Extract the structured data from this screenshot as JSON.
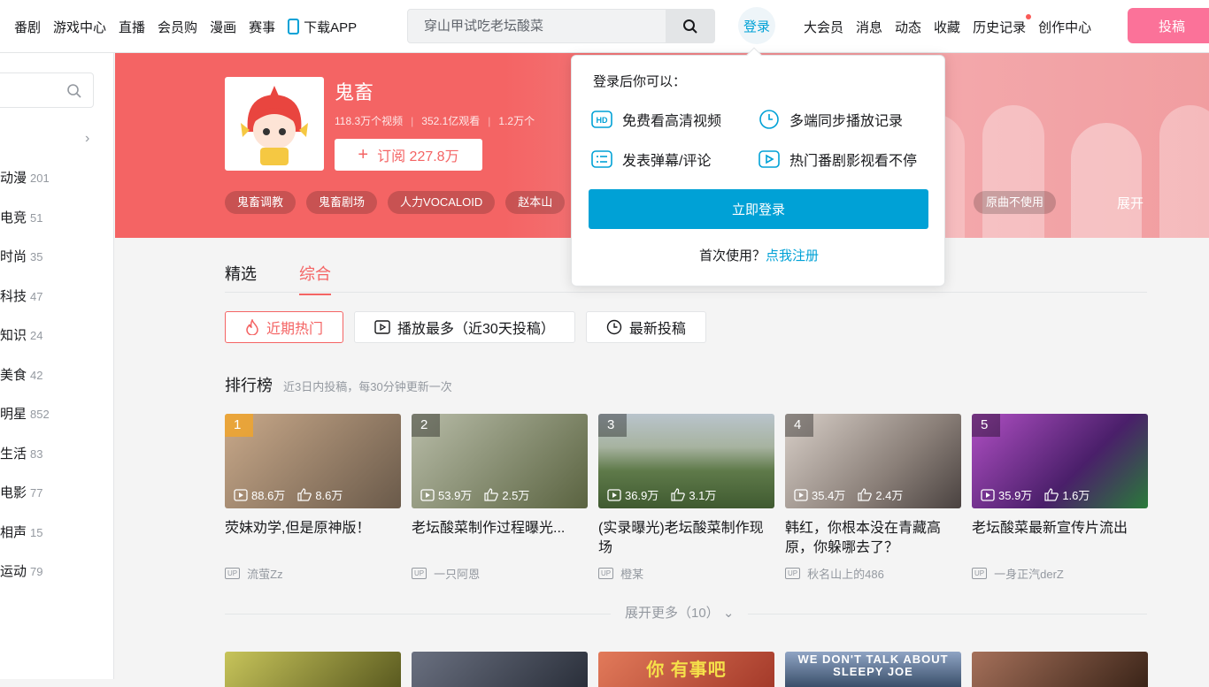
{
  "header": {
    "nav_left": [
      "番剧",
      "游戏中心",
      "直播",
      "会员购",
      "漫画",
      "赛事"
    ],
    "download_app": "下载APP",
    "search_placeholder": "穿山甲试吃老坛酸菜",
    "login": "登录",
    "nav_right": [
      "大会员",
      "消息",
      "动态",
      "收藏",
      "历史记录",
      "创作中心"
    ],
    "upload": "投稿"
  },
  "sidebar": {
    "items": [
      {
        "label": "动漫",
        "count": "201"
      },
      {
        "label": "电竞",
        "count": "51"
      },
      {
        "label": "时尚",
        "count": "35"
      },
      {
        "label": "科技",
        "count": "47"
      },
      {
        "label": "知识",
        "count": "24"
      },
      {
        "label": "美食",
        "count": "42"
      },
      {
        "label": "明星",
        "count": "852"
      },
      {
        "label": "生活",
        "count": "83"
      },
      {
        "label": "电影",
        "count": "77"
      },
      {
        "label": "相声",
        "count": "15"
      },
      {
        "label": "运动",
        "count": "79"
      }
    ]
  },
  "channel": {
    "name": "鬼畜",
    "videos": "118.3万个视频",
    "views": "352.1亿观看",
    "third": "1.2万个",
    "subscribe": "订阅 227.8万",
    "tags": [
      "鬼畜调教",
      "鬼畜剧场",
      "人力VOCALOID",
      "赵本山"
    ],
    "tag_right": "原曲不使用",
    "expand": "展开"
  },
  "tabs": [
    "精选",
    "综合"
  ],
  "filters": [
    "近期热门",
    "播放最多（近30天投稿）",
    "最新投稿"
  ],
  "ranking": {
    "title": "排行榜",
    "note": "近3日内投稿，每30分钟更新一次",
    "cards": [
      {
        "rank": "1",
        "plays": "88.6万",
        "likes": "8.6万",
        "title": "荧妹劝学,但是原神版！",
        "up": "流萤Zz",
        "color": "#7a6a58"
      },
      {
        "rank": "2",
        "plays": "53.9万",
        "likes": "2.5万",
        "title": "老坛酸菜制作过程曝光...",
        "up": "一只阿恩",
        "color": "#6d7654"
      },
      {
        "rank": "3",
        "plays": "36.9万",
        "likes": "3.1万",
        "title": "(实录曝光)老坛酸菜制作现场",
        "up": "橙某",
        "color": "#5f7a4a"
      },
      {
        "rank": "4",
        "plays": "35.4万",
        "likes": "2.4万",
        "title": "韩红，你根本没在青藏高原，你躲哪去了？",
        "up": "秋名山上的486",
        "color": "#8a7f78"
      },
      {
        "rank": "5",
        "plays": "35.9万",
        "likes": "1.6万",
        "title": "老坛酸菜最新宣传片流出",
        "up": "一身正汽derZ",
        "color": "#7a3f8c"
      }
    ],
    "more": "展开更多（10）"
  },
  "row2": [
    {
      "text": "",
      "color": "#8b8a3c"
    },
    {
      "text": "",
      "color": "#3a3f4a"
    },
    {
      "text": "你 有事吧",
      "color": "#c54a3a"
    },
    {
      "text": "WE DON'T TALK ABOUT SLEEPY JOE",
      "color": "#3a4f6a"
    },
    {
      "text": "",
      "color": "#5a3a2a"
    }
  ],
  "popup": {
    "title": "登录后你可以：",
    "benefits": [
      "免费看高清视频",
      "多端同步播放记录",
      "发表弹幕/评论",
      "热门番剧影视看不停"
    ],
    "login_button": "立即登录",
    "first_use": "首次使用？",
    "register": "点我注册"
  }
}
